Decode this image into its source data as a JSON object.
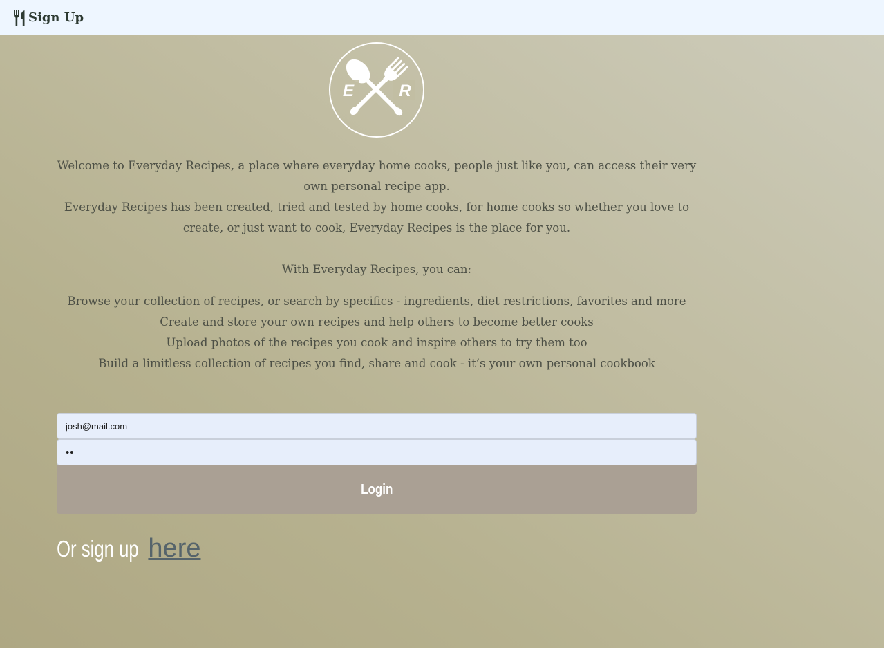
{
  "nav": {
    "brand_icon": "utensils-icon",
    "brand_label": "Sign Up"
  },
  "logo": {
    "left_letter": "E",
    "right_letter": "R"
  },
  "intro": {
    "paragraph_1": "Welcome to Everyday Recipes, a place where everyday home cooks, people just like you, can access their very own personal recipe app.",
    "paragraph_2": "Everyday Recipes has been created, tried and tested by home cooks, for home cooks so whether you love to create, or just want to cook, Everyday Recipes is the place for you.",
    "features_heading": "With Everyday Recipes, you can:",
    "features": [
      "Browse your collection of recipes, or search by specifics - ingredients, diet restrictions, favorites and more",
      "Create and store your own recipes and help others to become better cooks",
      "Upload photos of the recipes you cook and inspire others to try them too",
      "Build a limitless collection of recipes you find, share and cook - it’s your own personal cookbook"
    ]
  },
  "form": {
    "email_value": "josh@mail.com",
    "password_value": "••",
    "login_label": "Login"
  },
  "signup": {
    "prefix": "Or sign up",
    "link_label": "here"
  },
  "colors": {
    "navbar_bg": "#eef6ff",
    "button_bg": "#aaa094",
    "link": "#56646b",
    "text": "#4d5046"
  }
}
